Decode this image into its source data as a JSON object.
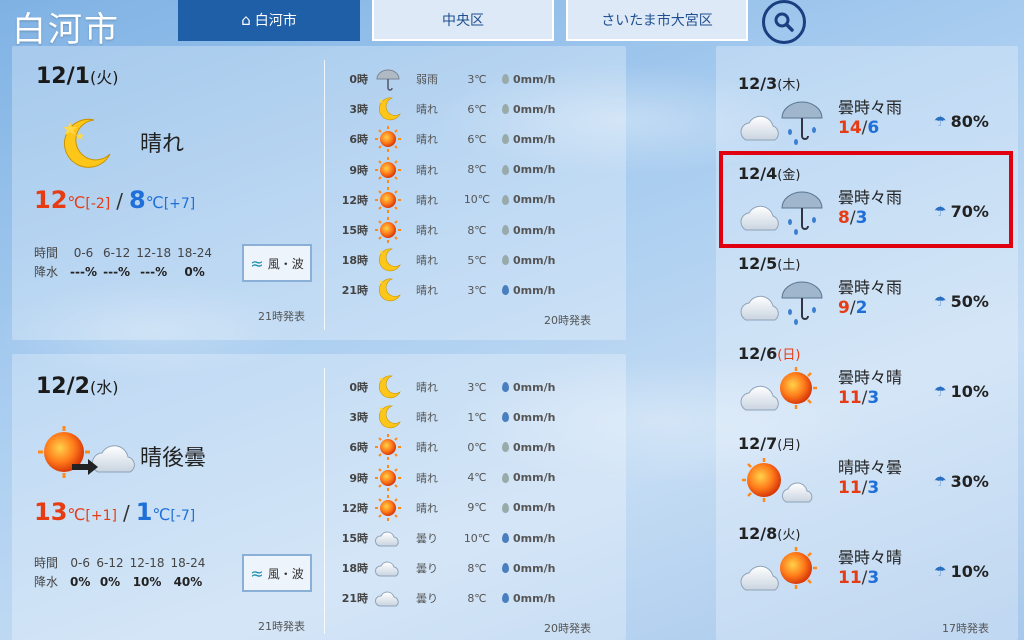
{
  "city_title": "白河市",
  "tabs": [
    {
      "label": "白河市",
      "active": true
    },
    {
      "label": "中央区",
      "active": false
    },
    {
      "label": "さいたま市大宮区",
      "active": false
    }
  ],
  "day1": {
    "date": "12/1",
    "dow": "(火)",
    "weather": "晴れ",
    "hi": "12",
    "hi_diff": "[-2]",
    "lo": "8",
    "lo_diff": "[+7]",
    "unit": "℃",
    "rain_header": [
      "時間",
      "0-6",
      "6-12",
      "12-18",
      "18-24"
    ],
    "rain_values": [
      "降水",
      "---%",
      "---%",
      "---%",
      "0%"
    ],
    "wind_label": "風・波",
    "issued": "21時発表",
    "hourly_issued": "20時発表",
    "hourly": [
      {
        "hour": "0時",
        "weather": "弱雨",
        "temp": "3℃",
        "precip": "0mm/h",
        "icon": "umbrella-icon"
      },
      {
        "hour": "3時",
        "weather": "晴れ",
        "temp": "6℃",
        "precip": "0mm/h",
        "icon": "moon-icon"
      },
      {
        "hour": "6時",
        "weather": "晴れ",
        "temp": "6℃",
        "precip": "0mm/h",
        "icon": "sun-icon"
      },
      {
        "hour": "9時",
        "weather": "晴れ",
        "temp": "8℃",
        "precip": "0mm/h",
        "icon": "sun-icon"
      },
      {
        "hour": "12時",
        "weather": "晴れ",
        "temp": "10℃",
        "precip": "0mm/h",
        "icon": "sun-icon"
      },
      {
        "hour": "15時",
        "weather": "晴れ",
        "temp": "8℃",
        "precip": "0mm/h",
        "icon": "sun-icon"
      },
      {
        "hour": "18時",
        "weather": "晴れ",
        "temp": "5℃",
        "precip": "0mm/h",
        "icon": "moon-icon"
      },
      {
        "hour": "21時",
        "weather": "晴れ",
        "temp": "3℃",
        "precip": "0mm/h",
        "icon": "moon-icon"
      }
    ]
  },
  "day2": {
    "date": "12/2",
    "dow": "(水)",
    "weather": "晴後曇",
    "hi": "13",
    "hi_diff": "[+1]",
    "lo": "1",
    "lo_diff": "[-7]",
    "unit": "℃",
    "rain_header": [
      "時間",
      "0-6",
      "6-12",
      "12-18",
      "18-24"
    ],
    "rain_values": [
      "降水",
      "0%",
      "0%",
      "10%",
      "40%"
    ],
    "wind_label": "風・波",
    "issued": "21時発表",
    "hourly_issued": "20時発表",
    "hourly": [
      {
        "hour": "0時",
        "weather": "晴れ",
        "temp": "3℃",
        "precip": "0mm/h",
        "icon": "moon-icon"
      },
      {
        "hour": "3時",
        "weather": "晴れ",
        "temp": "1℃",
        "precip": "0mm/h",
        "icon": "moon-icon"
      },
      {
        "hour": "6時",
        "weather": "晴れ",
        "temp": "0℃",
        "precip": "0mm/h",
        "icon": "sun-icon"
      },
      {
        "hour": "9時",
        "weather": "晴れ",
        "temp": "4℃",
        "precip": "0mm/h",
        "icon": "sun-icon"
      },
      {
        "hour": "12時",
        "weather": "晴れ",
        "temp": "9℃",
        "precip": "0mm/h",
        "icon": "sun-icon"
      },
      {
        "hour": "15時",
        "weather": "曇り",
        "temp": "10℃",
        "precip": "0mm/h",
        "icon": "cloud-icon"
      },
      {
        "hour": "18時",
        "weather": "曇り",
        "temp": "8℃",
        "precip": "0mm/h",
        "icon": "cloud-icon"
      },
      {
        "hour": "21時",
        "weather": "曇り",
        "temp": "8℃",
        "precip": "0mm/h",
        "icon": "cloud-icon"
      }
    ]
  },
  "weekly": {
    "issued": "17時発表",
    "days": [
      {
        "date": "12/3",
        "dow": "(木)",
        "weather": "曇時々雨",
        "hi": "14",
        "lo": "6",
        "pop": "80%",
        "icon": "cloud-rain-icon",
        "sunday": false
      },
      {
        "date": "12/4",
        "dow": "(金)",
        "weather": "曇時々雨",
        "hi": "8",
        "lo": "3",
        "pop": "70%",
        "icon": "cloud-rain-icon",
        "sunday": false
      },
      {
        "date": "12/5",
        "dow": "(土)",
        "weather": "曇時々雨",
        "hi": "9",
        "lo": "2",
        "pop": "50%",
        "icon": "cloud-rain-icon",
        "sunday": false
      },
      {
        "date": "12/6",
        "dow": "(日)",
        "weather": "曇時々晴",
        "hi": "11",
        "lo": "3",
        "pop": "10%",
        "icon": "cloud-sun-icon",
        "sunday": true
      },
      {
        "date": "12/7",
        "dow": "(月)",
        "weather": "晴時々曇",
        "hi": "11",
        "lo": "3",
        "pop": "30%",
        "icon": "sun-cloud-icon",
        "sunday": false
      },
      {
        "date": "12/8",
        "dow": "(火)",
        "weather": "曇時々晴",
        "hi": "11",
        "lo": "3",
        "pop": "10%",
        "icon": "cloud-sun-icon",
        "sunday": false
      }
    ]
  },
  "colors": {
    "hi": "#e63b13",
    "lo": "#1f6fd8",
    "accent": "#1f5fa8",
    "highlight": "#e00010"
  }
}
